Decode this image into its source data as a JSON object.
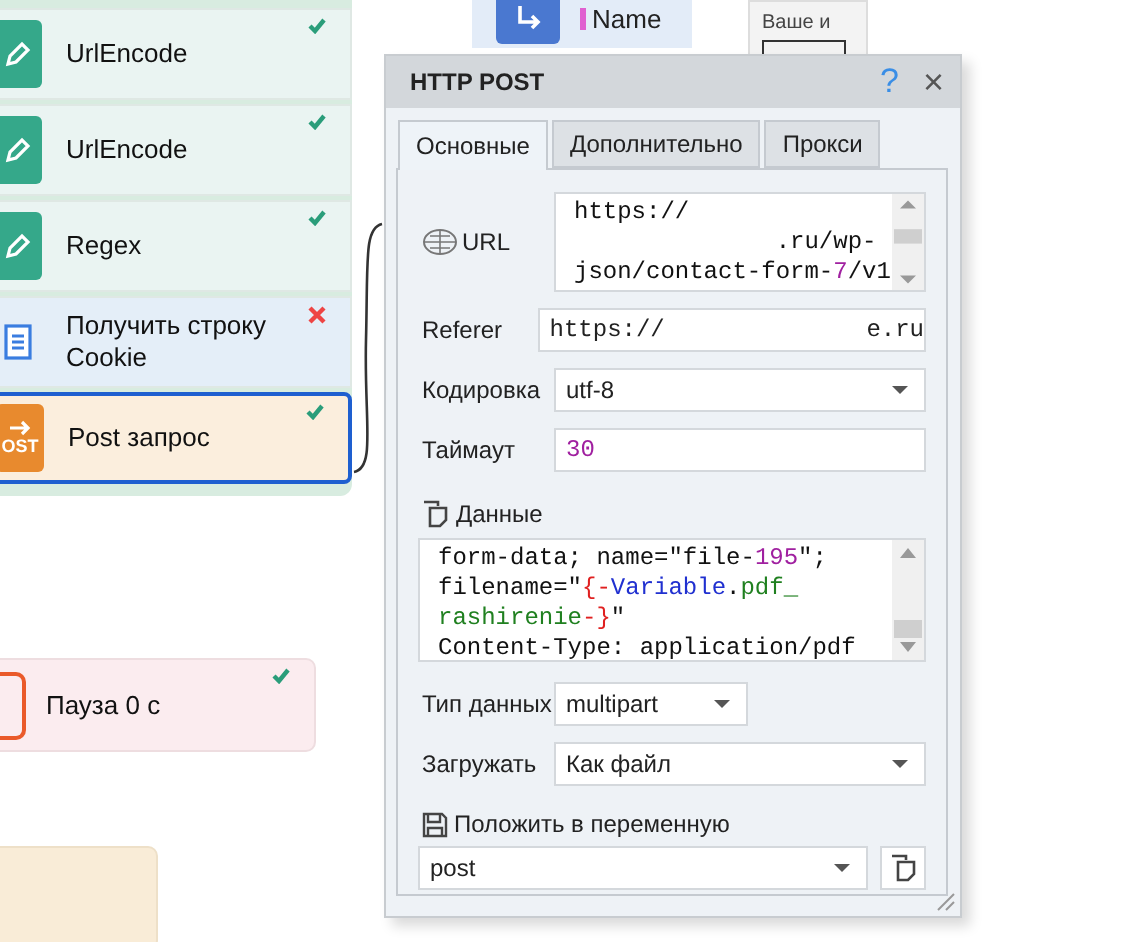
{
  "canvas": {
    "group_nodes": [
      {
        "label": "UrlEncode",
        "kind": "edit",
        "succeeded": true,
        "selected": false
      },
      {
        "label": "UrlEncode",
        "kind": "edit",
        "succeeded": true,
        "selected": false
      },
      {
        "label": "Regex",
        "kind": "edit",
        "succeeded": true,
        "selected": false
      },
      {
        "label": "Получить строку Cookie",
        "kind": "list",
        "succeeded": false,
        "selected": false
      },
      {
        "label": "Post запрос",
        "kind": "post",
        "icon_text": "OST",
        "succeeded": true,
        "selected": true
      }
    ],
    "pause_node": {
      "label": "Пауза 0 с",
      "succeeded": true
    },
    "name_node": {
      "label": "Name"
    },
    "form_node": {
      "label": "Ваше и"
    }
  },
  "dialog": {
    "title": "HTTP POST",
    "help": "?",
    "close": "×",
    "tabs": [
      {
        "label": "Основные",
        "selected": true
      },
      {
        "label": "Дополнительно",
        "selected": false
      },
      {
        "label": "Прокси",
        "selected": false
      }
    ],
    "url": {
      "label": "URL",
      "lines": [
        [
          {
            "kind": "text",
            "text": "https://"
          }
        ],
        [
          {
            "kind": "text",
            "text": "              .ru/wp-"
          }
        ],
        [
          {
            "kind": "text",
            "text": "json/contact-form-"
          },
          {
            "kind": "number",
            "text": "7"
          },
          {
            "kind": "text",
            "text": "/v1"
          }
        ]
      ]
    },
    "referer": {
      "label": "Referer",
      "value": "https://              e.ru"
    },
    "encoding": {
      "label": "Кодировка",
      "value": "utf-8"
    },
    "timeout": {
      "label": "Таймаут",
      "value": "30"
    },
    "data": {
      "label": "Данные",
      "lines": [
        [
          {
            "kind": "text",
            "text": "form-data; name=\"file-"
          },
          {
            "kind": "number",
            "text": "195"
          },
          {
            "kind": "text",
            "text": "\";"
          }
        ],
        [
          {
            "kind": "text",
            "text": "filename=\""
          },
          {
            "kind": "brace",
            "text": "{-"
          },
          {
            "kind": "var",
            "text": "Variable"
          },
          {
            "kind": "text",
            "text": "."
          },
          {
            "kind": "ext",
            "text": "pdf_"
          }
        ],
        [
          {
            "kind": "ext",
            "text": "rashirenie"
          },
          {
            "kind": "brace",
            "text": "-}"
          },
          {
            "kind": "text",
            "text": "\""
          }
        ],
        [
          {
            "kind": "text",
            "text": "Content-Type: application/pdf"
          }
        ]
      ]
    },
    "data_type": {
      "label": "Тип данных",
      "value": "multipart"
    },
    "upload": {
      "label": "Загружать",
      "value": "Как файл"
    },
    "save": {
      "label": "Положить в переменную",
      "value": "post"
    }
  }
}
